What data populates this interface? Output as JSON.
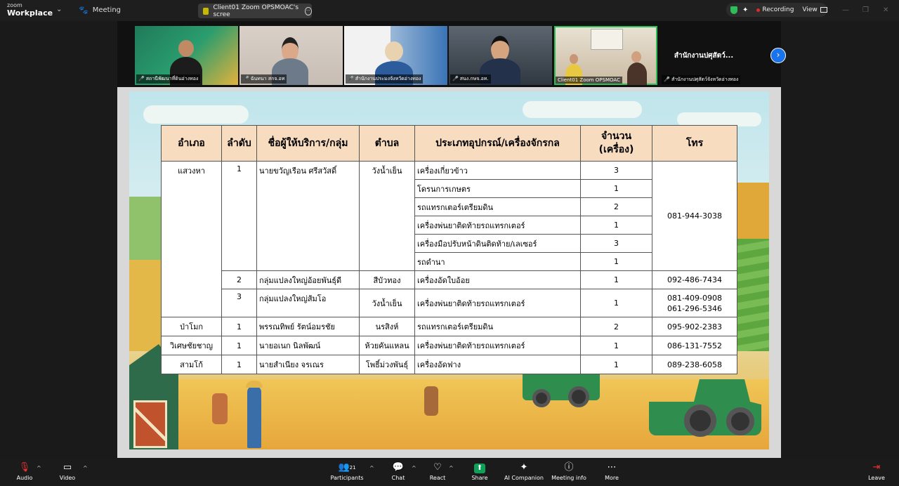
{
  "topbar": {
    "brand_small": "zoom",
    "brand_big": "Workplace",
    "meeting_label": "Meeting",
    "share_tab": "Client01 Zoom OPSMOAC's scree",
    "recording": "Recording",
    "view": "View"
  },
  "filmstrip": {
    "tiles": [
      {
        "caption": "สถานีพัฒนาที่ดินอ่างทอง"
      },
      {
        "caption": "ฉันทนา สกจ.อท"
      },
      {
        "caption": "สำนักงานประมงจังหวัดอ่างทอง"
      },
      {
        "caption": "สนง.กษจ.อท."
      },
      {
        "caption": "Client01 Zoom OPSMOAC"
      }
    ],
    "name_tile": "สำนักงานปศุสัตว์...",
    "name_tile_caption": "สำนักงานปศุสัตว์จังหวัดอ่างทอง"
  },
  "table": {
    "headers": {
      "district": "อำเภอ",
      "order": "ลำดับ",
      "provider": "ชื่อผู้ให้บริการ/กลุ่ม",
      "subdistrict": "ตำบล",
      "equipment": "ประเภทอุปกรณ์/เครื่องจักรกล",
      "quantity_line1": "จำนวน",
      "quantity_line2": "(เครื่อง)",
      "phone": "โทร"
    },
    "d1": "แสวงหา",
    "d1_order1": "1",
    "d1_provider1": "นายขวัญเรือน ศรีสวัสดิ์",
    "d1_sub1": "วังน้ำเย็น",
    "d1_phone1": "081-944-3038",
    "d1_items": [
      {
        "equipment": "เครื่องเกี่ยวข้าว",
        "qty": "3"
      },
      {
        "equipment": "โดรนการเกษตร",
        "qty": "1"
      },
      {
        "equipment": "รถแทรกเตอร์เตรียมดิน",
        "qty": "2"
      },
      {
        "equipment": "เครื่องพ่นยาติดท้ายรถแทรกเตอร์",
        "qty": "1"
      },
      {
        "equipment": "เครื่องมือปรับหน้าดินติดท้าย/เลเซอร์",
        "qty": "3"
      },
      {
        "equipment": "รถดำนา",
        "qty": "1"
      }
    ],
    "d1_row2": {
      "order": "2",
      "provider": "กลุ่มแปลงใหญ่อ้อยพันธุ์ดี",
      "sub": "สีบัวทอง",
      "equipment": "เครื่องอัดใบอ้อย",
      "qty": "1",
      "phone": "092-486-7434"
    },
    "d1_row3": {
      "order": "3",
      "provider": "กลุ่มแปลงใหญ่ส้มโอ",
      "sub": "วังน้ำเย็น",
      "equipment": "เครื่องพ่นยาติดท้ายรถแทรกเตอร์",
      "qty": "1",
      "phone1": "081-409-0908",
      "phone2": "061-296-5346"
    },
    "rows": [
      {
        "district": "ป่าโมก",
        "order": "1",
        "provider": "พรรณทิพย์ รัตน์อมรชัย",
        "sub": "นรสิงห์",
        "equipment": "รถแทรกเตอร์เตรียมดิน",
        "qty": "2",
        "phone": "095-902-2383"
      },
      {
        "district": "วิเศษชัยชาญ",
        "order": "1",
        "provider": "นายอเนก นิลพัฒน์",
        "sub": "ห้วยคันแหลน",
        "equipment": "เครื่องพ่นยาติดท้ายรถแทรกเตอร์",
        "qty": "1",
        "phone": "086-131-7552"
      },
      {
        "district": "สามโก้",
        "order": "1",
        "provider": "นายสำเนียง จรเณร",
        "sub": "โพธิ์ม่วงพันธุ์",
        "equipment": "เครื่องอัดฟาง",
        "qty": "1",
        "phone": "089-238-6058"
      }
    ]
  },
  "toolbar": {
    "audio": "Audio",
    "video": "Video",
    "participants": "Participants",
    "participants_count": "21",
    "chat": "Chat",
    "react": "React",
    "share": "Share",
    "ai_companion": "AI Companion",
    "meeting_info": "Meeting info",
    "more": "More",
    "leave": "Leave"
  },
  "colors": {
    "share_green": "#0e9f58",
    "header_fill": "#f8dcc0",
    "next_blue": "#1a73e8",
    "recording_red": "#e02a2a"
  }
}
